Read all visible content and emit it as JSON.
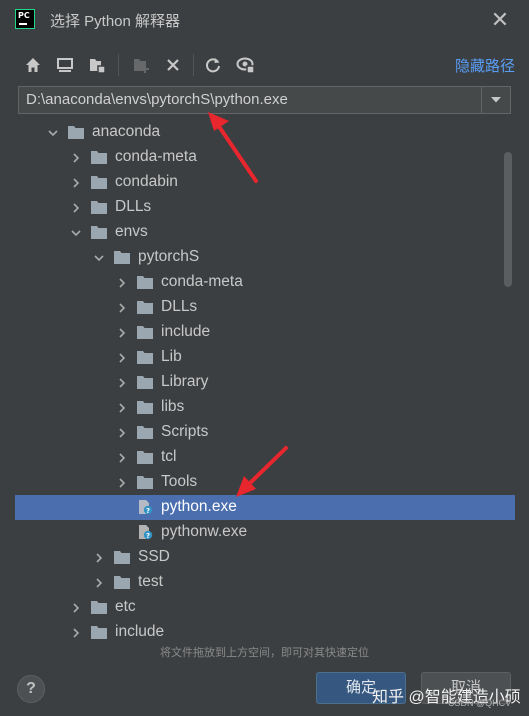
{
  "window": {
    "title": "选择 Python 解释器",
    "logo_text": "PC"
  },
  "toolbar": {
    "buttons": [
      {
        "name": "home-button",
        "icon": "home-icon"
      },
      {
        "name": "desktop-button",
        "icon": "desktop-icon"
      },
      {
        "name": "project-button",
        "icon": "project-folder-icon"
      },
      {
        "name": "new-folder-button",
        "icon": "new-folder-icon",
        "disabled": true
      },
      {
        "name": "delete-button",
        "icon": "delete-icon"
      },
      {
        "name": "refresh-button",
        "icon": "refresh-icon"
      },
      {
        "name": "show-hidden-button",
        "icon": "show-hidden-icon"
      }
    ],
    "hide_path_label": "隐藏路径"
  },
  "path_field": {
    "value": "D:\\anaconda\\envs\\pytorchS\\python.exe"
  },
  "tree": {
    "rows": [
      {
        "label": "anaconda",
        "level": 0,
        "expanded": true,
        "type": "folder"
      },
      {
        "label": "conda-meta",
        "level": 1,
        "expanded": false,
        "type": "folder"
      },
      {
        "label": "condabin",
        "level": 1,
        "expanded": false,
        "type": "folder"
      },
      {
        "label": "DLLs",
        "level": 1,
        "expanded": false,
        "type": "folder"
      },
      {
        "label": "envs",
        "level": 1,
        "expanded": true,
        "type": "folder"
      },
      {
        "label": "pytorchS",
        "level": 2,
        "expanded": true,
        "type": "folder"
      },
      {
        "label": "conda-meta",
        "level": 3,
        "expanded": false,
        "type": "folder"
      },
      {
        "label": "DLLs",
        "level": 3,
        "expanded": false,
        "type": "folder"
      },
      {
        "label": "include",
        "level": 3,
        "expanded": false,
        "type": "folder"
      },
      {
        "label": "Lib",
        "level": 3,
        "expanded": false,
        "type": "folder"
      },
      {
        "label": "Library",
        "level": 3,
        "expanded": false,
        "type": "folder"
      },
      {
        "label": "libs",
        "level": 3,
        "expanded": false,
        "type": "folder"
      },
      {
        "label": "Scripts",
        "level": 3,
        "expanded": false,
        "type": "folder"
      },
      {
        "label": "tcl",
        "level": 3,
        "expanded": false,
        "type": "folder"
      },
      {
        "label": "Tools",
        "level": 3,
        "expanded": false,
        "type": "folder"
      },
      {
        "label": "python.exe",
        "level": 3,
        "type": "file",
        "selected": true
      },
      {
        "label": "pythonw.exe",
        "level": 3,
        "type": "file"
      },
      {
        "label": "SSD",
        "level": 2,
        "expanded": false,
        "type": "folder"
      },
      {
        "label": "test",
        "level": 2,
        "expanded": false,
        "type": "folder"
      },
      {
        "label": "etc",
        "level": 1,
        "expanded": false,
        "type": "folder"
      },
      {
        "label": "include",
        "level": 1,
        "expanded": false,
        "type": "folder"
      }
    ]
  },
  "footer": {
    "drop_hint": "将文件拖放到上方空间，即可对其快速定位",
    "help_label": "?",
    "ok_label": "确定",
    "cancel_label": "取消"
  },
  "watermark": {
    "text": "知乎 @智能建造小硕",
    "csdn": "CSDN @QHCV"
  },
  "colors": {
    "background": "#3c3f41",
    "selection": "#4b6eaf",
    "link": "#589df6",
    "annotation_arrow": "#e8262d"
  }
}
